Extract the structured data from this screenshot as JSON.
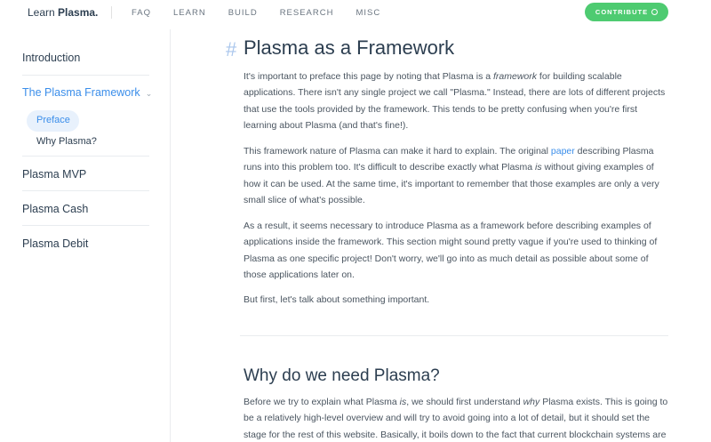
{
  "header": {
    "logo_light": "Learn ",
    "logo_bold": "Plasma.",
    "nav": [
      "FAQ",
      "LEARN",
      "BUILD",
      "RESEARCH",
      "MISC"
    ],
    "contribute_label": "CONTRIBUTE"
  },
  "sidebar": {
    "items": [
      {
        "label": "Introduction"
      },
      {
        "label": "The Plasma Framework",
        "chevron": "⌄"
      },
      {
        "label": "Plasma MVP"
      },
      {
        "label": "Plasma Cash"
      },
      {
        "label": "Plasma Debit"
      }
    ],
    "subitems": [
      {
        "label": "Preface"
      },
      {
        "label": "Why Plasma?"
      }
    ]
  },
  "content": {
    "hash": "#",
    "title": "Plasma as a Framework",
    "p1": {
      "a": "It's important to preface this page by noting that Plasma is a ",
      "em": "framework",
      "b": " for building scalable applications. There isn't any single project we call \"Plasma.\" Instead, there are lots of different projects that use the tools provided by the framework. This tends to be pretty confusing when you're first learning about Plasma (and that's fine!)."
    },
    "p2": {
      "a": "This framework nature of Plasma can make it hard to explain. The original ",
      "link": "paper",
      "b": " describing Plasma runs into this problem too. It's difficult to describe exactly what Plasma ",
      "em": "is",
      "c": " without giving examples of how it can be used. At the same time, it's important to remember that those examples are only a very small slice of what's possible."
    },
    "p3": "As a result, it seems necessary to introduce Plasma as a framework before describing examples of applications inside the framework. This section might sound pretty vague if you're used to thinking of Plasma as one specific project! Don't worry, we'll go into as much detail as possible about some of those applications later on.",
    "p4": "But first, let's talk about something important.",
    "h2": "Why do we need Plasma?",
    "p5": {
      "a": "Before we try to explain what Plasma ",
      "em1": "is",
      "b": ", we should first understand ",
      "em2": "why",
      "c": " Plasma exists. This is going to be a relatively high-level overview and will try to avoid going into a lot of detail, but it should set the stage for the rest of this website. Basically, it boils down to the fact that current blockchain systems are pretty slow by"
    }
  }
}
